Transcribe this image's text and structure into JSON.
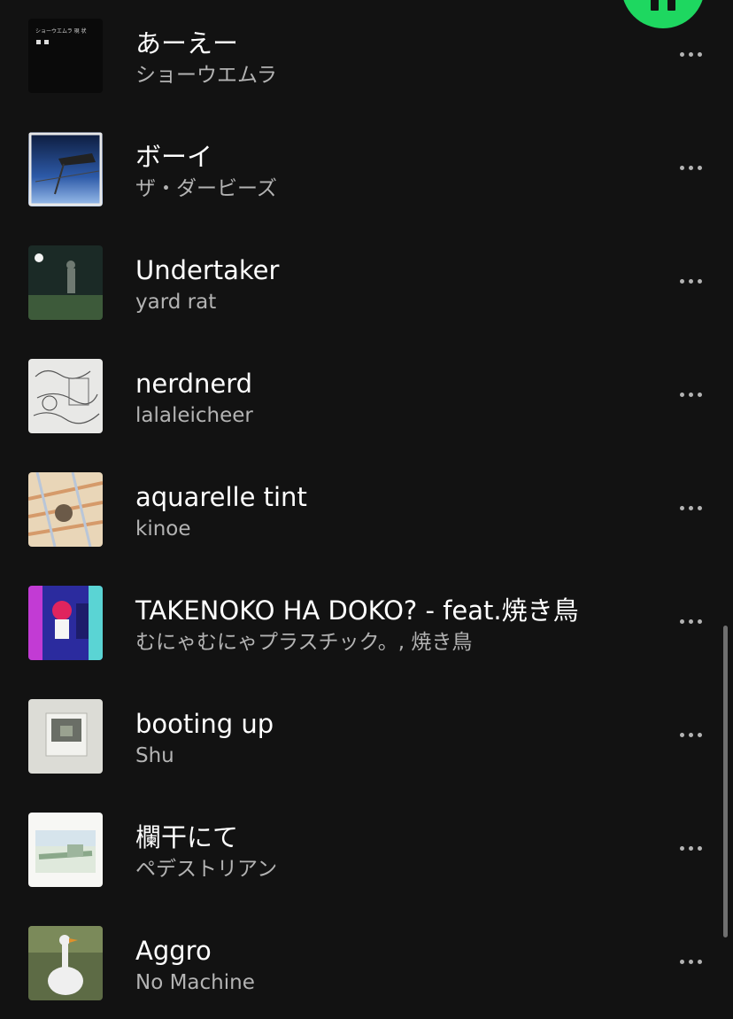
{
  "colors": {
    "background": "#121212",
    "title": "#ffffff",
    "subtitle": "#b3b3b3",
    "accent": "#1ed760"
  },
  "icons": {
    "play_button": "pause-icon",
    "more": "more-options-icon"
  },
  "tracks": [
    {
      "title": "あーえー",
      "artist": "ショーウエムラ",
      "art_text": "ショーウエムラ 現 状"
    },
    {
      "title": "ボーイ",
      "artist": "ザ・ダービーズ"
    },
    {
      "title": "Undertaker",
      "artist": "yard rat"
    },
    {
      "title": "nerdnerd",
      "artist": "lalaleicheer"
    },
    {
      "title": "aquarelle tint",
      "artist": "kinoe"
    },
    {
      "title": "TAKENOKO HA DOKO? - feat.焼き鳥",
      "artist": "むにゃむにゃプラスチック。, 焼き鳥"
    },
    {
      "title": "booting up",
      "artist": "Shu"
    },
    {
      "title": "欄干にて",
      "artist": "ペデストリアン"
    },
    {
      "title": "Aggro",
      "artist": "No Machine"
    }
  ]
}
